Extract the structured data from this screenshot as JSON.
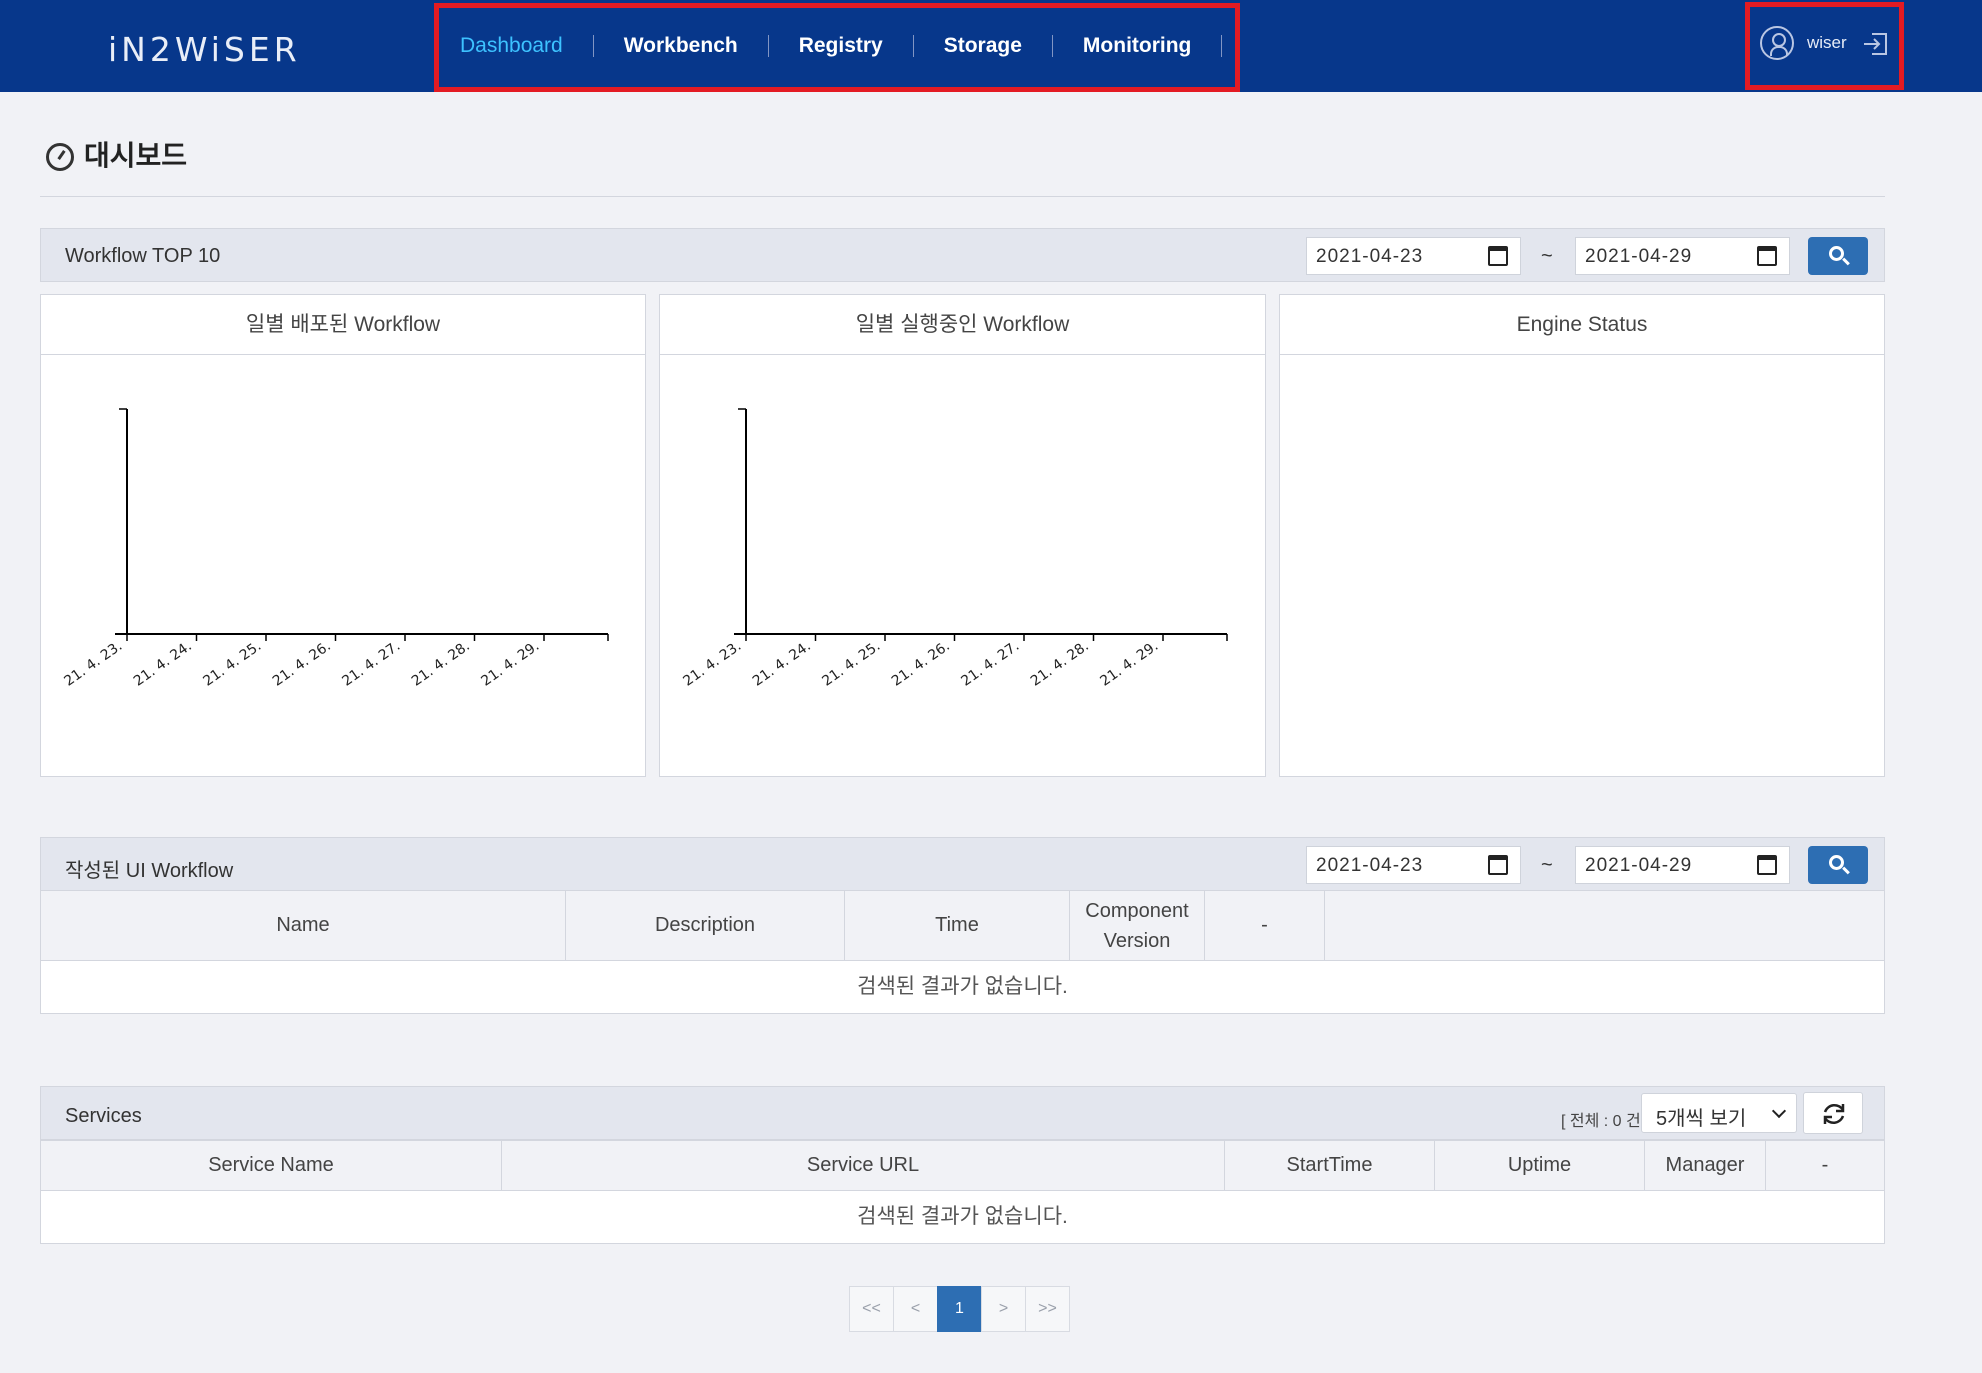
{
  "app": {
    "logo_text": "iN2WiSER"
  },
  "nav": {
    "items": [
      "Dashboard",
      "Workbench",
      "Registry",
      "Storage",
      "Monitoring"
    ],
    "active": "Dashboard"
  },
  "user": {
    "name": "wiser"
  },
  "page": {
    "title": "대시보드"
  },
  "workflow_top10": {
    "title": "Workflow TOP 10",
    "start_date": "2021-04-23",
    "end_date": "2021-04-29",
    "separator": "~"
  },
  "panels": {
    "deployed": {
      "title": "일별 배포된 Workflow"
    },
    "running": {
      "title": "일별 실행중인 Workflow"
    },
    "engine": {
      "title": "Engine Status"
    }
  },
  "chart_data": [
    {
      "type": "bar",
      "title": "일별 배포된 Workflow",
      "categories": [
        "21. 4. 23.",
        "21. 4. 24.",
        "21. 4. 25.",
        "21. 4. 26.",
        "21. 4. 27.",
        "21. 4. 28.",
        "21. 4. 29."
      ],
      "values": []
    },
    {
      "type": "bar",
      "title": "일별 실행중인 Workflow",
      "categories": [
        "21. 4. 23.",
        "21. 4. 24.",
        "21. 4. 25.",
        "21. 4. 26.",
        "21. 4. 27.",
        "21. 4. 28.",
        "21. 4. 29."
      ],
      "values": []
    }
  ],
  "ui_workflow": {
    "title": "작성된 UI Workflow",
    "start_date": "2021-04-23",
    "end_date": "2021-04-29",
    "separator": "~",
    "columns": [
      "Name",
      "Description",
      "Time",
      "Component Version",
      "-"
    ],
    "empty_message": "검색된 결과가 없습니다."
  },
  "services": {
    "title": "Services",
    "total_text": "[ 전체 : 0 건 ]",
    "page_size": "5개씩 보기",
    "columns": [
      "Service Name",
      "Service URL",
      "StartTime",
      "Uptime",
      "Manager",
      "-"
    ],
    "empty_message": "검색된 결과가 없습니다."
  },
  "pagination": {
    "first": "<<",
    "prev": "<",
    "current": "1",
    "next": ">",
    "last": ">>"
  }
}
